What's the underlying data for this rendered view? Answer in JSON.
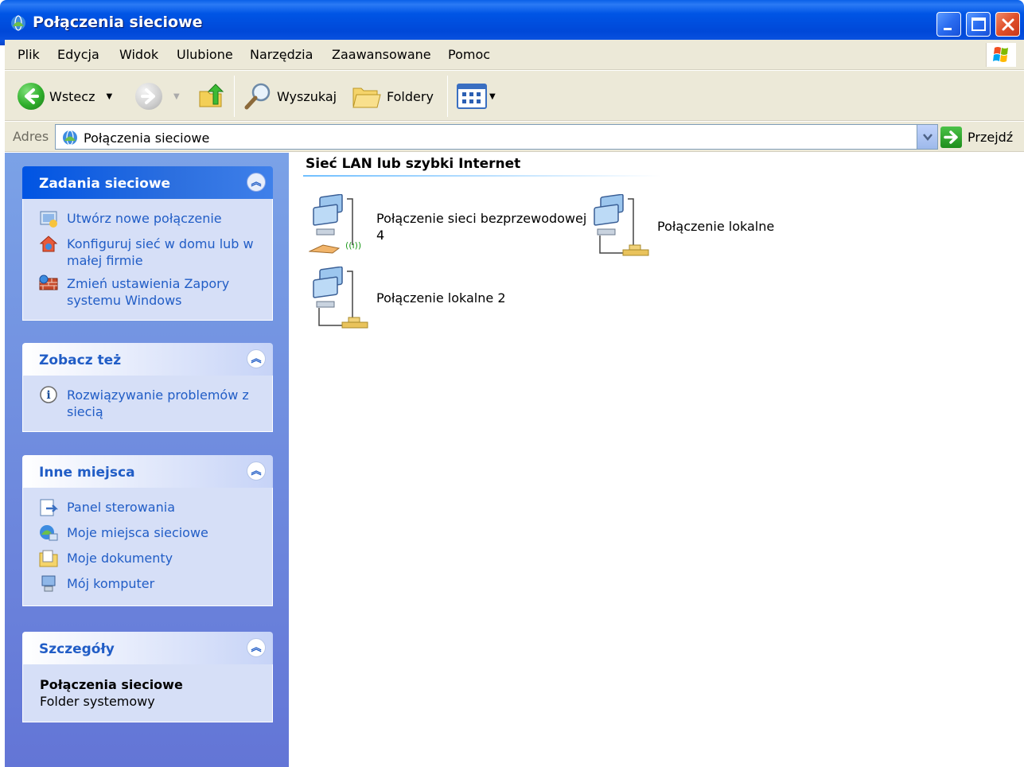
{
  "window": {
    "title": "Połączenia sieciowe"
  },
  "menu": {
    "items": [
      "Plik",
      "Edycja",
      "Widok",
      "Ulubione",
      "Narzędzia",
      "Zaawansowane",
      "Pomoc"
    ]
  },
  "toolbar": {
    "back_label": "Wstecz",
    "search_label": "Wyszukaj",
    "folders_label": "Foldery"
  },
  "address": {
    "label": "Adres",
    "value": "Połączenia sieciowe",
    "go_label": "Przejdź"
  },
  "sidebar": {
    "network_tasks": {
      "title": "Zadania sieciowe",
      "items": [
        {
          "label": "Utwórz nowe połączenie",
          "icon": "new-connection-icon"
        },
        {
          "label": "Konfiguruj sieć w domu lub w małej firmie",
          "icon": "home-network-icon"
        },
        {
          "label": "Zmień ustawienia Zapory systemu Windows",
          "icon": "firewall-icon"
        }
      ]
    },
    "see_also": {
      "title": "Zobacz też",
      "items": [
        {
          "label": "Rozwiązywanie problemów z siecią",
          "icon": "info-icon"
        }
      ]
    },
    "other_places": {
      "title": "Inne miejsca",
      "items": [
        {
          "label": "Panel sterowania",
          "icon": "control-panel-icon"
        },
        {
          "label": "Moje miejsca sieciowe",
          "icon": "network-places-icon"
        },
        {
          "label": "Moje dokumenty",
          "icon": "my-documents-icon"
        },
        {
          "label": "Mój komputer",
          "icon": "my-computer-icon"
        }
      ]
    },
    "details": {
      "title": "Szczegóły",
      "name": "Połączenia sieciowe",
      "type": "Folder systemowy"
    }
  },
  "content": {
    "group_title": "Sieć LAN lub szybki Internet",
    "connections": [
      {
        "line1": "Połączenie sieci bezprzewodowej",
        "line2": "4",
        "icon": "wireless-connection-icon"
      },
      {
        "line1": "Połączenie lokalne",
        "line2": "",
        "icon": "lan-connection-icon"
      },
      {
        "line1": "Połączenie lokalne 2",
        "line2": "",
        "icon": "lan-connection-icon"
      }
    ]
  },
  "colors": {
    "titlebar": "#0054e3",
    "sidebar": "#7ba2e7",
    "link": "#215dc6",
    "chrome": "#ece9d8"
  }
}
